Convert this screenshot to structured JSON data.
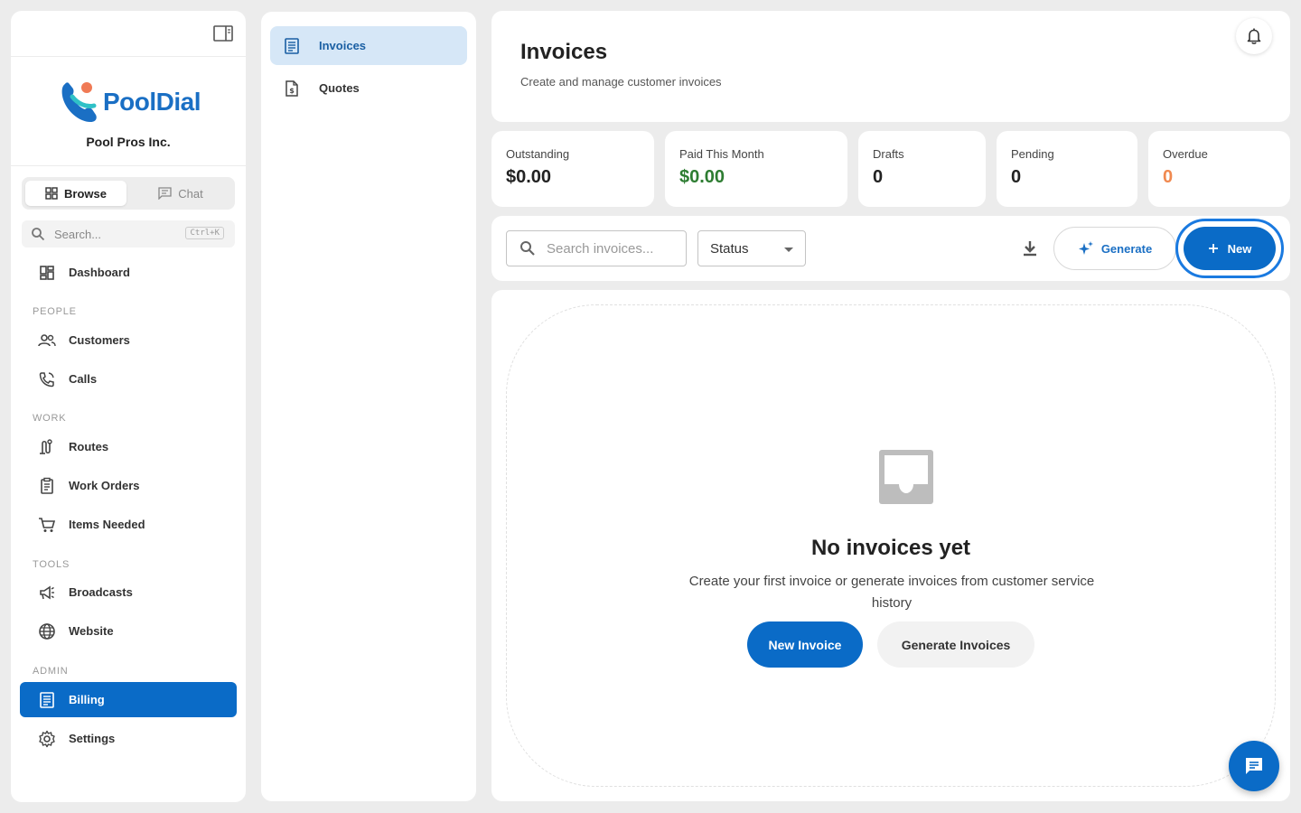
{
  "sidebar": {
    "brand_name": "PoolDial",
    "org_name": "Pool Pros Inc.",
    "tabs": {
      "browse": "Browse",
      "chat": "Chat"
    },
    "search": {
      "placeholder": "Search...",
      "shortcut": "Ctrl+K"
    },
    "dashboard": "Dashboard",
    "sections": {
      "people": "PEOPLE",
      "work": "WORK",
      "tools": "TOOLS",
      "admin": "ADMIN"
    },
    "items": {
      "customers": "Customers",
      "calls": "Calls",
      "routes": "Routes",
      "work_orders": "Work Orders",
      "items_needed": "Items Needed",
      "broadcasts": "Broadcasts",
      "website": "Website",
      "billing": "Billing",
      "settings": "Settings"
    }
  },
  "subnav": {
    "invoices": "Invoices",
    "quotes": "Quotes"
  },
  "header": {
    "title": "Invoices",
    "subtitle": "Create and manage customer invoices"
  },
  "stats": [
    {
      "label": "Outstanding",
      "value": "$0.00",
      "color": "#222222"
    },
    {
      "label": "Paid This Month",
      "value": "$0.00",
      "color": "#2e7d32"
    },
    {
      "label": "Drafts",
      "value": "0",
      "color": "#222222"
    },
    {
      "label": "Pending",
      "value": "0",
      "color": "#222222"
    },
    {
      "label": "Overdue",
      "value": "0",
      "color": "#f0894f"
    }
  ],
  "toolbar": {
    "search_placeholder": "Search invoices...",
    "status_label": "Status",
    "generate_label": "Generate",
    "new_label": "New"
  },
  "empty_state": {
    "title": "No invoices yet",
    "description": "Create your first invoice or generate invoices from customer service history",
    "primary_label": "New Invoice",
    "secondary_label": "Generate Invoices"
  },
  "colors": {
    "accent": "#0a6bc7",
    "accent_light": "#d6e7f7"
  }
}
